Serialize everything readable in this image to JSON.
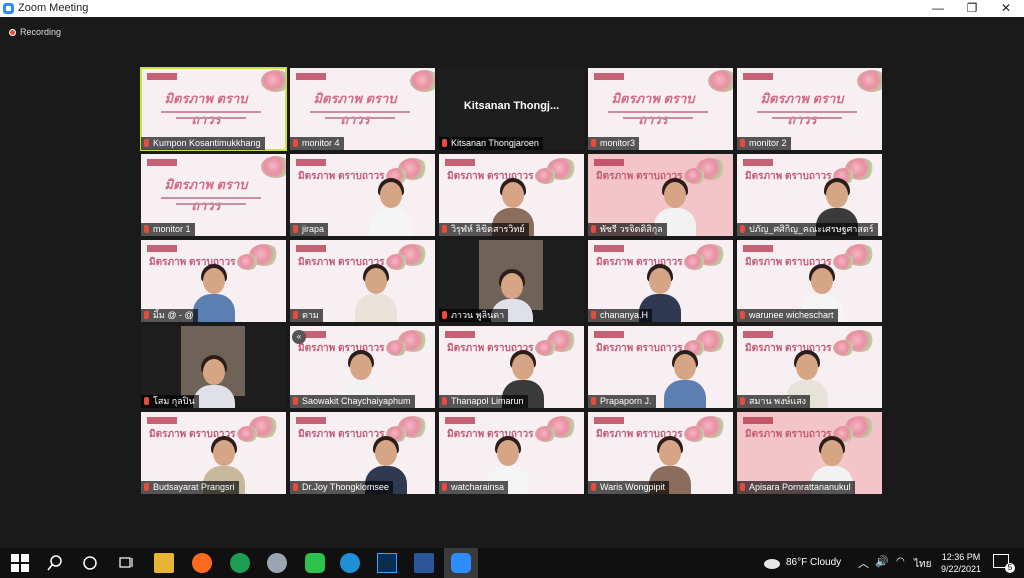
{
  "window": {
    "title": "Zoom Meeting",
    "minimize": "—",
    "maximize": "❐",
    "close": "✕"
  },
  "recording": "Recording",
  "participants": [
    {
      "name": "Kumpon Kosantimukkhang",
      "kind": "slide",
      "active": true
    },
    {
      "name": "monitor 4",
      "kind": "slide"
    },
    {
      "name": "Kitsanan Thongjaroen",
      "kind": "text",
      "big": "Kitsanan  Thongj..."
    },
    {
      "name": "monitor3",
      "kind": "slide"
    },
    {
      "name": "monitor 2",
      "kind": "slide"
    },
    {
      "name": "monitor 1",
      "kind": "slide"
    },
    {
      "name": "jirapa",
      "kind": "person"
    },
    {
      "name": "วิรุฬห์ ลิขิตสารวิทย์",
      "kind": "person"
    },
    {
      "name": "พัชรี วรจิตติสิกุล",
      "kind": "person",
      "pink": true
    },
    {
      "name": "ปภัญ_ศศิกิญ_คณะเศรษฐศาสตร์",
      "kind": "person"
    },
    {
      "name": "มิ้ม @ - @",
      "kind": "person"
    },
    {
      "name": "ตาม",
      "kind": "person"
    },
    {
      "name": "ภาวน พูลินดา",
      "kind": "camera"
    },
    {
      "name": "chananya.H",
      "kind": "person"
    },
    {
      "name": "warunee wicheschart",
      "kind": "person"
    },
    {
      "name": "โสม กุลปิน",
      "kind": "camera"
    },
    {
      "name": "Saowakit Chaychaiyaphum",
      "kind": "person",
      "arrow": "«"
    },
    {
      "name": "Thanapol Limarun",
      "kind": "person"
    },
    {
      "name": "Prapaporn J.",
      "kind": "person"
    },
    {
      "name": "สมาน พงษ์แสง",
      "kind": "person"
    },
    {
      "name": "Budsayarat Prangsri",
      "kind": "person"
    },
    {
      "name": "Dr.Joy Thongklomsee",
      "kind": "person"
    },
    {
      "name": "watcharainsa",
      "kind": "person"
    },
    {
      "name": "Waris Wongpipit",
      "kind": "person"
    },
    {
      "name": "Apisara Pornrattananukul",
      "kind": "person",
      "pink": true
    }
  ],
  "slide_title": "มิตรภาพ ตราบถาวร",
  "taskbar": {
    "weather": "86°F  Cloudy",
    "language": "ไทย",
    "time": "12:36 PM",
    "date": "9/22/2021",
    "notifications": "5"
  },
  "colors": {
    "active_outline": "#c9e343",
    "mic_muted": "#e84b3c",
    "zoom_blue": "#2d8cff"
  }
}
